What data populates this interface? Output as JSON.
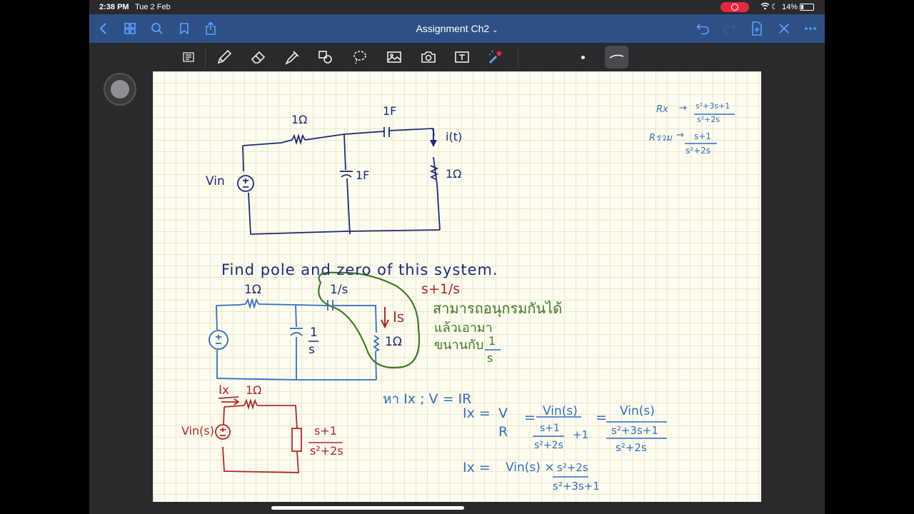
{
  "status": {
    "time": "2:38 PM",
    "date": "Tue 2 Feb",
    "battery": "14%"
  },
  "nav": {
    "title": "Assignment Ch2"
  },
  "colors": {
    "nav_bg": "#2d5185",
    "paper": "#fdfcef",
    "ink_navy": "#1d2a7a",
    "ink_blue": "#2f6fc5",
    "ink_red": "#b3262b",
    "ink_green": "#3e7a24"
  },
  "icons": [
    "back-icon",
    "thumbnails-icon",
    "search-icon",
    "bookmark-icon",
    "share-icon",
    "undo-icon",
    "redo-icon",
    "add-page-icon",
    "close-icon",
    "more-icon",
    "reading-mode-icon",
    "pen-icon",
    "eraser-icon",
    "highlighter-icon",
    "shapes-icon",
    "lasso-icon",
    "image-icon",
    "camera-icon",
    "text-icon",
    "laser-pointer-icon"
  ],
  "notes": {
    "top_circuit": {
      "r1": "1Ω",
      "c_top": "1F",
      "current": "i(t)",
      "c_mid": "1F",
      "r2": "1Ω",
      "source": "Vin"
    },
    "side_note": {
      "rx": "Rx",
      "rx_num": "s²+3s+1",
      "rx_den": "s²+2s",
      "rtotal": "Rรวม",
      "rt_num": "s+1",
      "rt_den": "s²+2s"
    },
    "task": "Find pole and zero of this system.",
    "mid_circuit": {
      "r1": "1Ω",
      "c_top": "1/s",
      "c_mid_num": "1",
      "c_mid_den": "s",
      "current": "Is",
      "r2": "1Ω"
    },
    "green_note": {
      "expr": "s+1/s",
      "line1": "สามารถอนุกรมกันได้",
      "line2": "แล้วเอามา",
      "line3": "ขนานกับ",
      "frac_num": "1",
      "frac_den": "s"
    },
    "red_circuit": {
      "current": "Ix",
      "r1": "1Ω",
      "source": "Vin(s)",
      "z_num": "s+1",
      "z_den": "s²+2s"
    },
    "work": {
      "line1": "หา  Ix  ;   V = IR",
      "ix": "Ix =",
      "v": "V",
      "r": "R",
      "eq": "=",
      "vin": "Vin(s)",
      "inner_num": "s+1",
      "inner_den": "s²+2s",
      "plus1": "+1",
      "eq2": "=",
      "vin2": "Vin(s)",
      "den2": "s²+3s+1",
      "den2b": "s²+2s",
      "final_lhs": "Ix =",
      "final_mid": "Vin(s) ×",
      "final_num": "s²+2s",
      "final_den": "s²+3s+1"
    }
  }
}
